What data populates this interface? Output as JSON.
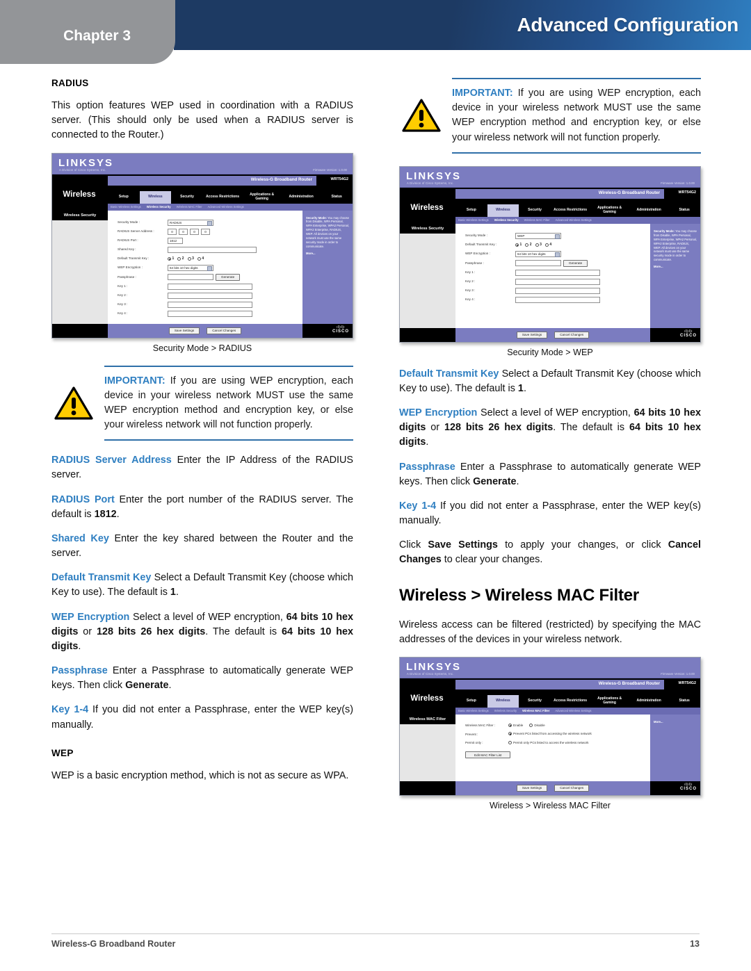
{
  "header": {
    "chapter_label": "Chapter 3",
    "title": "Advanced Configuration",
    "band_color_start": "#1d3a63",
    "band_color_end": "#2f7ec0",
    "tab_color": "#939598"
  },
  "footer": {
    "document_title": "Wireless-G Broadband Router",
    "page_number": "13"
  },
  "colors": {
    "term_blue": "#2f7fc1",
    "rule_blue": "#2f6fa8",
    "ui_purple": "#7b7cc0",
    "warning_yellow": "#ffcc00"
  },
  "left_column": {
    "radius_heading": "RADIUS",
    "radius_intro": "This option features WEP used in coordination with a RADIUS server. (This should only be used when a RADIUS server is connected to the Router.)",
    "figure_caption": "Security Mode > RADIUS",
    "important": {
      "label": "IMPORTANT:",
      "text": " If you are using WEP encryption, each device in your wireless network MUST use the same WEP encryption method and encryption key, or else your wireless network will not function properly."
    },
    "paragraphs": [
      {
        "term": "RADIUS Server Address",
        "text": " Enter the IP Address of the RADIUS server."
      },
      {
        "term": "RADIUS Port",
        "text": "  Enter the port number of the RADIUS server. The default is ",
        "bold": "1812",
        "tail": "."
      },
      {
        "term": "Shared Key",
        "text": " Enter the key shared between the Router and the server."
      },
      {
        "term": "Default Transmit Key",
        "text": " Select a Default Transmit Key (choose which Key to use). The default is ",
        "bold": "1",
        "tail": "."
      }
    ],
    "wep_encryption_para": {
      "term": "WEP Encryption",
      "t1": " Select a level of WEP encryption, ",
      "b1": "64 bits 10 hex digits",
      "t2": " or ",
      "b2": "128 bits 26 hex digits",
      "t3": ". The default is ",
      "b3": "64 bits 10 hex digits",
      "t4": "."
    },
    "passphrase_para": {
      "term": "Passphrase",
      "t1": "  Enter a Passphrase to automatically generate WEP keys. Then click ",
      "b1": "Generate",
      "t2": "."
    },
    "key_para": {
      "term": "Key 1-4",
      "t1": "  If you did not enter a Passphrase, enter the WEP key(s) manually."
    },
    "wep_heading": "WEP",
    "wep_intro": "WEP is a basic encryption method, which is not as secure as WPA."
  },
  "right_column": {
    "important": {
      "label": "IMPORTANT:",
      "text": " If you are using WEP encryption, each device in your wireless network MUST use the same WEP encryption method and encryption key, or else your wireless network will not function properly."
    },
    "figure_caption_wep": "Security Mode > WEP",
    "default_transmit_key_para": {
      "term": "Default Transmit Key",
      "t1": " Select a Default Transmit Key (choose which Key to use). The default is ",
      "b1": "1",
      "t2": "."
    },
    "wep_encryption_para": {
      "term": "WEP Encryption",
      "t1": "  Select a level of WEP encryption, ",
      "b1": "64 bits 10 hex digits",
      "t2": " or ",
      "b2": "128 bits 26 hex digits",
      "t3": ". The default is ",
      "b3": "64 bits 10 hex digits",
      "t4": "."
    },
    "passphrase_para": {
      "term": "Passphrase",
      "t1": "  Enter a Passphrase to automatically generate WEP keys. Then click ",
      "b1": "Generate",
      "t2": "."
    },
    "key_para": {
      "term": "Key 1-4",
      "t1": "  If you did not enter a Passphrase, enter the WEP key(s) manually."
    },
    "save_para": {
      "t1": "Click ",
      "b1": "Save Settings",
      "t2": " to apply your changes, or click ",
      "b2": "Cancel Changes",
      "t3": " to clear your changes."
    },
    "mac_filter_heading": "Wireless > Wireless MAC Filter",
    "mac_filter_intro": "Wireless access can be filtered (restricted) by specifying the MAC addresses of the devices in your wireless network.",
    "figure_caption_mac": "Wireless > Wireless MAC Filter"
  },
  "router_ui": {
    "brand": "LINKSYS",
    "brand_sub": "A Division of Cisco Systems, Inc.",
    "firmware": "Firmware Version: 1.0.00",
    "product_name": "Wireless-G Broadband Router",
    "model": "WRT54G2",
    "section_wireless": "Wireless",
    "tabs": [
      "Setup",
      "Wireless",
      "Security",
      "Access Restrictions",
      "Applications & Gaming",
      "Administration",
      "Status"
    ],
    "active_tab": "Wireless",
    "subtabs_security": [
      "Basic Wireless Settings",
      "Wireless Security",
      "Wireless MAC Filter",
      "Advanced Wireless Settings"
    ],
    "active_subtab_security": "Wireless Security",
    "active_subtab_mac": "Wireless MAC Filter",
    "left_cap_security": "Wireless Security",
    "left_cap_mac": "Wireless MAC Filter",
    "help_security": {
      "lead": "Security Mode:",
      "text": " You may choose from Disable, WPA Personal, WPA Enterprise, WPA2 Personal, WPA2 Enterprise, RADIUS, WEP. All devices on your network must use the same security mode in order to communicate.",
      "more": "More..."
    },
    "help_mac": {
      "more": "More..."
    },
    "buttons": {
      "save": "Save Settings",
      "cancel": "Cancel Changes",
      "generate": "Generate",
      "edit_mac_list": "Edit MAC Filter List"
    },
    "cisco_word": "CISCO",
    "radius_form": {
      "security_mode_label": "Security Mode :",
      "security_mode_value": "RADIUS",
      "server_address_label": "RADIUS Server Address :",
      "server_address_octets": [
        "0",
        "0",
        "0",
        "0"
      ],
      "port_label": "RADIUS Port :",
      "port_value": "1812",
      "shared_key_label": "Shared Key :",
      "shared_key_value": "",
      "default_transmit_key_label": "Default Transmit Key :",
      "default_transmit_key_options": [
        "1",
        "2",
        "3",
        "4"
      ],
      "default_transmit_key_selected": "1",
      "wep_encryption_label": "WEP Encryption :",
      "wep_encryption_value": "64 bits 10 hex digits",
      "passphrase_label": "Passphrase :",
      "passphrase_value": "",
      "key_labels": [
        "Key 1 :",
        "Key 2 :",
        "Key 3 :",
        "Key 4 :"
      ],
      "key_values": [
        "",
        "",
        "",
        ""
      ]
    },
    "wep_form": {
      "security_mode_label": "Security Mode :",
      "security_mode_value": "WEP",
      "default_transmit_key_label": "Default Transmit Key :",
      "default_transmit_key_options": [
        "1",
        "2",
        "3",
        "4"
      ],
      "default_transmit_key_selected": "1",
      "wep_encryption_label": "WEP Encryption :",
      "wep_encryption_value": "64 bits 10 hex digits",
      "passphrase_label": "Passphrase :",
      "passphrase_value": "",
      "key_labels": [
        "Key 1 :",
        "Key 2 :",
        "Key 3 :",
        "Key 4 :"
      ],
      "key_values": [
        "",
        "",
        "",
        ""
      ]
    },
    "mac_form": {
      "filter_label": "Wireless MAC Filter :",
      "enable_label": "Enable",
      "disable_label": "Disable",
      "filter_selected": "Enable",
      "prevent_label": "Prevent :",
      "prevent_text": "Prevent PCs listed from accessing the wireless network",
      "permit_label": "Permit only :",
      "permit_text": "Permit only PCs listed to access the wireless network",
      "access_selected": "Prevent"
    }
  }
}
